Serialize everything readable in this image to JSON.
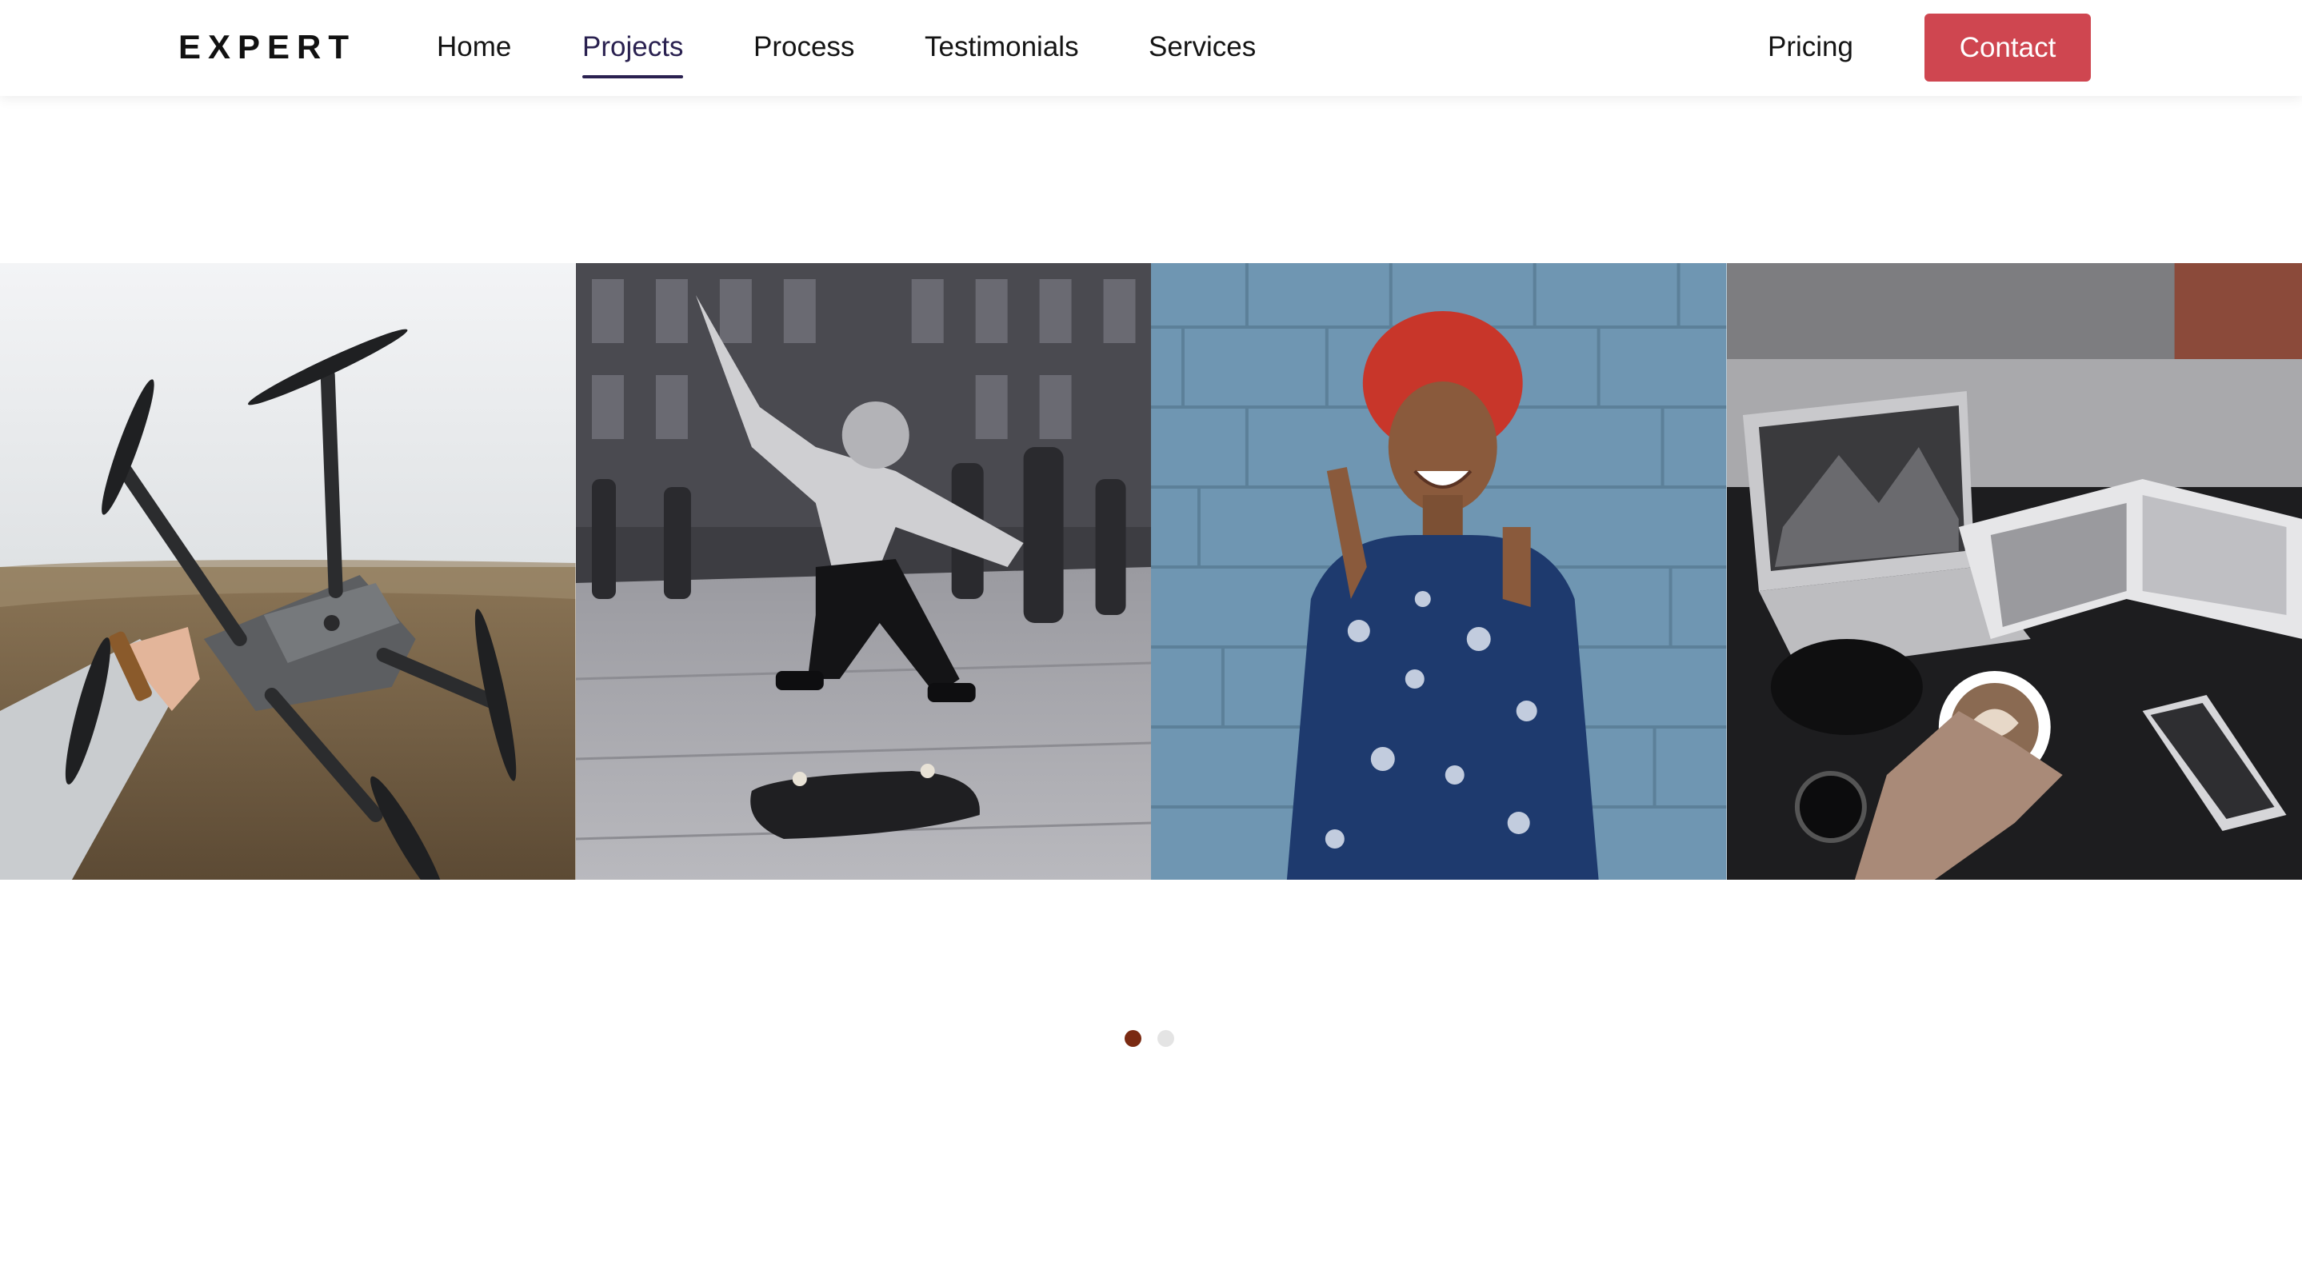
{
  "brand": {
    "logo_text": "EXPERT"
  },
  "nav": {
    "items": [
      {
        "label": "Home",
        "active": false
      },
      {
        "label": "Projects",
        "active": true
      },
      {
        "label": "Process",
        "active": false
      },
      {
        "label": "Testimonials",
        "active": false
      },
      {
        "label": "Services",
        "active": false
      }
    ],
    "pricing_label": "Pricing",
    "contact_label": "Contact"
  },
  "colors": {
    "accent": "#cf4650",
    "active_nav": "#2a2150",
    "dot_active": "#7a2a12",
    "dot_inactive": "#e4e4e4"
  },
  "carousel": {
    "slides": [
      {
        "icon": "drone-photo"
      },
      {
        "icon": "skateboarder-photo"
      },
      {
        "icon": "smiling-woman-photo"
      },
      {
        "icon": "laptop-coffee-photo"
      }
    ],
    "page_count": 2,
    "active_page": 1
  }
}
